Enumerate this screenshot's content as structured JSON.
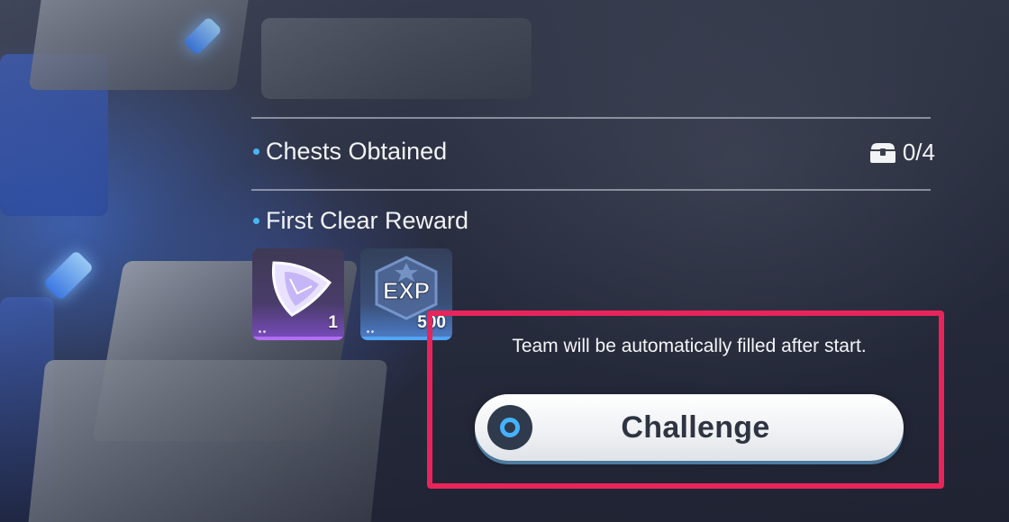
{
  "panel": {
    "chests": {
      "label": "Chests Obtained",
      "count": "0/4",
      "icon": "treasure-chest-icon"
    },
    "first_clear": {
      "label": "First Clear Reward",
      "rewards": [
        {
          "name": "crystal-gem",
          "icon": "crystal-gem-icon",
          "quantity": "1",
          "accent": "#b26ef2"
        },
        {
          "name": "exp",
          "icon": "exp-badge-icon",
          "art_text": "EXP",
          "quantity": "500",
          "accent": "#52a4f5"
        }
      ]
    }
  },
  "auto_fill_notice": "Team will be automatically filled after start.",
  "challenge_button": {
    "label": "Challenge",
    "icon": "circle-button-icon"
  },
  "colors": {
    "highlight": "#e8245a",
    "bullet": "#48b6f2",
    "button_ring": "#44b3ff"
  }
}
